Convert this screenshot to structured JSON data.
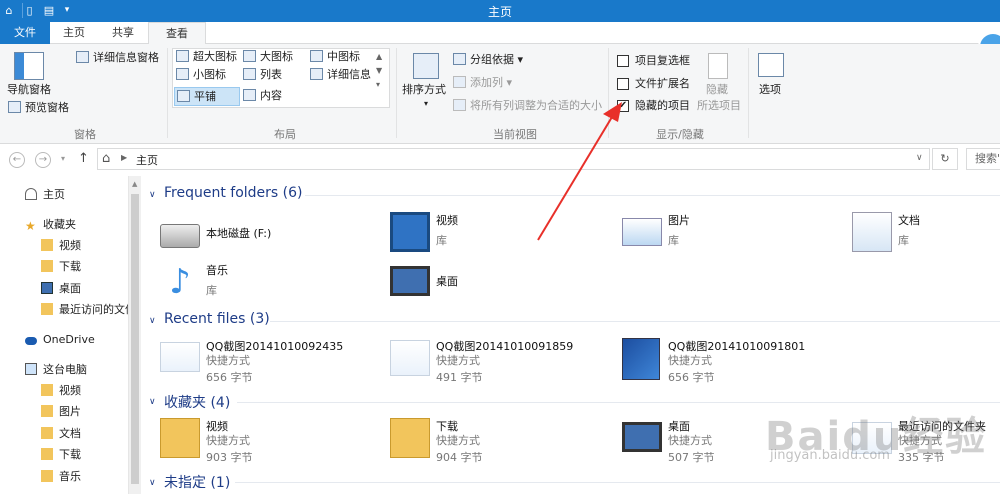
{
  "window": {
    "title": "主页"
  },
  "ribbon_tabs": [
    "文件",
    "主页",
    "共享",
    "查看"
  ],
  "panes_group": {
    "nav_pane": "导航窗格",
    "preview_pane": "预览窗格",
    "details_pane": "详细信息窗格",
    "label": "窗格"
  },
  "layout_group": {
    "options": [
      "超大图标",
      "大图标",
      "中图标",
      "小图标",
      "列表",
      "详细信息",
      "平铺",
      "内容"
    ],
    "selected": "平铺",
    "label": "布局"
  },
  "current_view_group": {
    "sort_by": "排序方式",
    "group_by": "分组依据",
    "add_column": "添加列",
    "fit_columns": "将所有列调整为合适的大小",
    "label": "当前视图"
  },
  "show_hide_group": {
    "checkboxes": [
      {
        "label": "项目复选框",
        "checked": false
      },
      {
        "label": "文件扩展名",
        "checked": false
      },
      {
        "label": "隐藏的项目",
        "checked": true
      }
    ],
    "hide_selected_1": "隐藏",
    "hide_selected_2": "所选项目",
    "label": "显示/隐藏"
  },
  "options_label": "选项",
  "address": {
    "path": "主页",
    "search_placeholder": "搜索\""
  },
  "nav_pane": {
    "home": "主页",
    "favorites": "收藏夹",
    "fav_items": [
      "视频",
      "下载",
      "桌面",
      "最近访问的文件"
    ],
    "onedrive": "OneDrive",
    "this_pc": "这台电脑",
    "pc_items": [
      "视频",
      "图片",
      "文档",
      "下载",
      "音乐"
    ]
  },
  "sections": {
    "frequent": "Frequent folders (6)",
    "recent": "Recent files (3)",
    "favorites": "收藏夹 (4)",
    "unspecified": "未指定 (1)"
  },
  "frequent_folders": [
    {
      "name": "本地磁盘 (F:)",
      "sub": ""
    },
    {
      "name": "视频",
      "sub": "库"
    },
    {
      "name": "图片",
      "sub": "库"
    },
    {
      "name": "文档",
      "sub": "库"
    },
    {
      "name": "音乐",
      "sub": "库"
    },
    {
      "name": "桌面",
      "sub": ""
    }
  ],
  "recent_files": [
    {
      "name": "QQ截图20141010092435",
      "type": "快捷方式",
      "size": "656 字节"
    },
    {
      "name": "QQ截图20141010091859",
      "type": "快捷方式",
      "size": "491 字节"
    },
    {
      "name": "QQ截图20141010091801",
      "type": "快捷方式",
      "size": "656 字节"
    }
  ],
  "favorites_items": [
    {
      "name": "视频",
      "type": "快捷方式",
      "size": "903 字节"
    },
    {
      "name": "下载",
      "type": "快捷方式",
      "size": "904 字节"
    },
    {
      "name": "桌面",
      "type": "快捷方式",
      "size": "507 字节"
    },
    {
      "name": "最近访问的文件夹",
      "type": "快捷方式",
      "size": "335 字节"
    }
  ],
  "watermark": {
    "main": "Baidu经验",
    "sub": "jingyan.baidu.com"
  },
  "colors": {
    "accent": "#1979ca",
    "section": "#1e3c87",
    "arrow": "#e8302a"
  }
}
